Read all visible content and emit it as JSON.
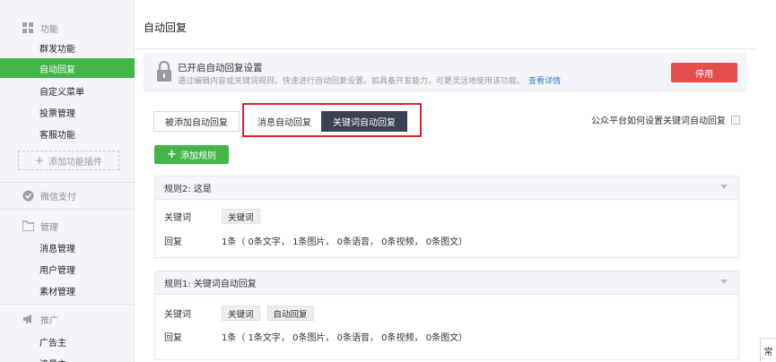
{
  "sidebar": {
    "sections": [
      {
        "title": "功能",
        "icon": "grid-icon",
        "items": [
          "群发功能",
          "自动回复",
          "自定义菜单",
          "投票管理",
          "客服功能"
        ]
      },
      {
        "title": "微信支付",
        "icon": "check-circle-icon",
        "items": []
      },
      {
        "title": "管理",
        "icon": "folder-icon",
        "items": [
          "消息管理",
          "用户管理",
          "素材管理"
        ]
      },
      {
        "title": "推广",
        "icon": "megaphone-icon",
        "items": [
          "广告主",
          "流量主"
        ]
      }
    ],
    "add_plugin": "添加功能插件",
    "active": "自动回复"
  },
  "main": {
    "title": "自动回复",
    "status": {
      "title": "已开启自动回复设置",
      "desc": "通过编辑内容或关键词规则，快速进行自动回复设置。如具备开发能力，可更灵活地使用该功能。",
      "link": "查看详情",
      "button": "停用",
      "button_color": "#e64e4e"
    },
    "tabs": [
      "被添加自动回复",
      "消息自动回复",
      "关键词自动回复"
    ],
    "active_tab": "关键词自动回复",
    "faq": "公众平台如何设置关键词自动回复",
    "add_rule": "添加规则",
    "keyword_label": "关键词",
    "reply_label": "回复",
    "rules": [
      {
        "title": "规则2: 这是",
        "keywords": [
          "关键词"
        ],
        "reply": "1条（ 0条文字， 1条图片， 0条语音， 0条视频， 0条图文）"
      },
      {
        "title": "规则1: 关键词自动回复",
        "keywords": [
          "关键词",
          "自动回复"
        ],
        "reply": "1条（ 1条文字， 0条图片， 0条语音， 0条视频， 0条图文）"
      }
    ]
  },
  "edge_text": "常",
  "accent_color": "#44b549",
  "highlight_color": "#d8232a"
}
